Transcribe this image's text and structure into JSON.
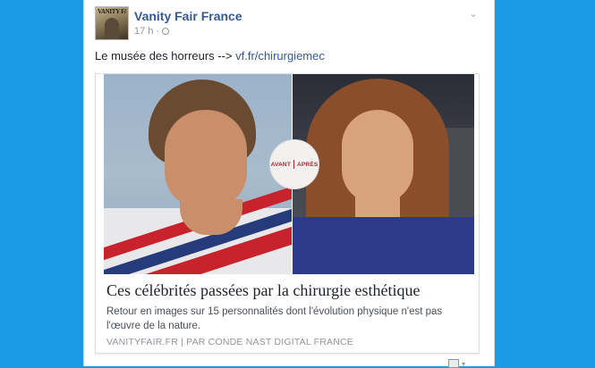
{
  "post": {
    "page_name": "Vanity Fair France",
    "timestamp": "17 h",
    "separator": "·",
    "privacy_icon": "globe-icon",
    "menu_icon": "chevron-down-icon",
    "text_prefix": "Le musée des horreurs -->",
    "link_text": "vf.fr/chirurgiemec",
    "avatar_masthead": "VANITY FAIR"
  },
  "link_preview": {
    "badge_left": "AVANT",
    "badge_right": "APRÈS",
    "headline": "Ces célébrités passées par la chirurgie esthétique",
    "description": "Retour en images sur 15 personnalités dont l'évolution physique n'est pas l'œuvre de la nature.",
    "source": "VANITYFAIR.FR | PAR CONDE NAST DIGITAL FRANCE"
  },
  "colors": {
    "background": "#1a9be4",
    "link": "#365899",
    "badge_text": "#b3262b"
  }
}
